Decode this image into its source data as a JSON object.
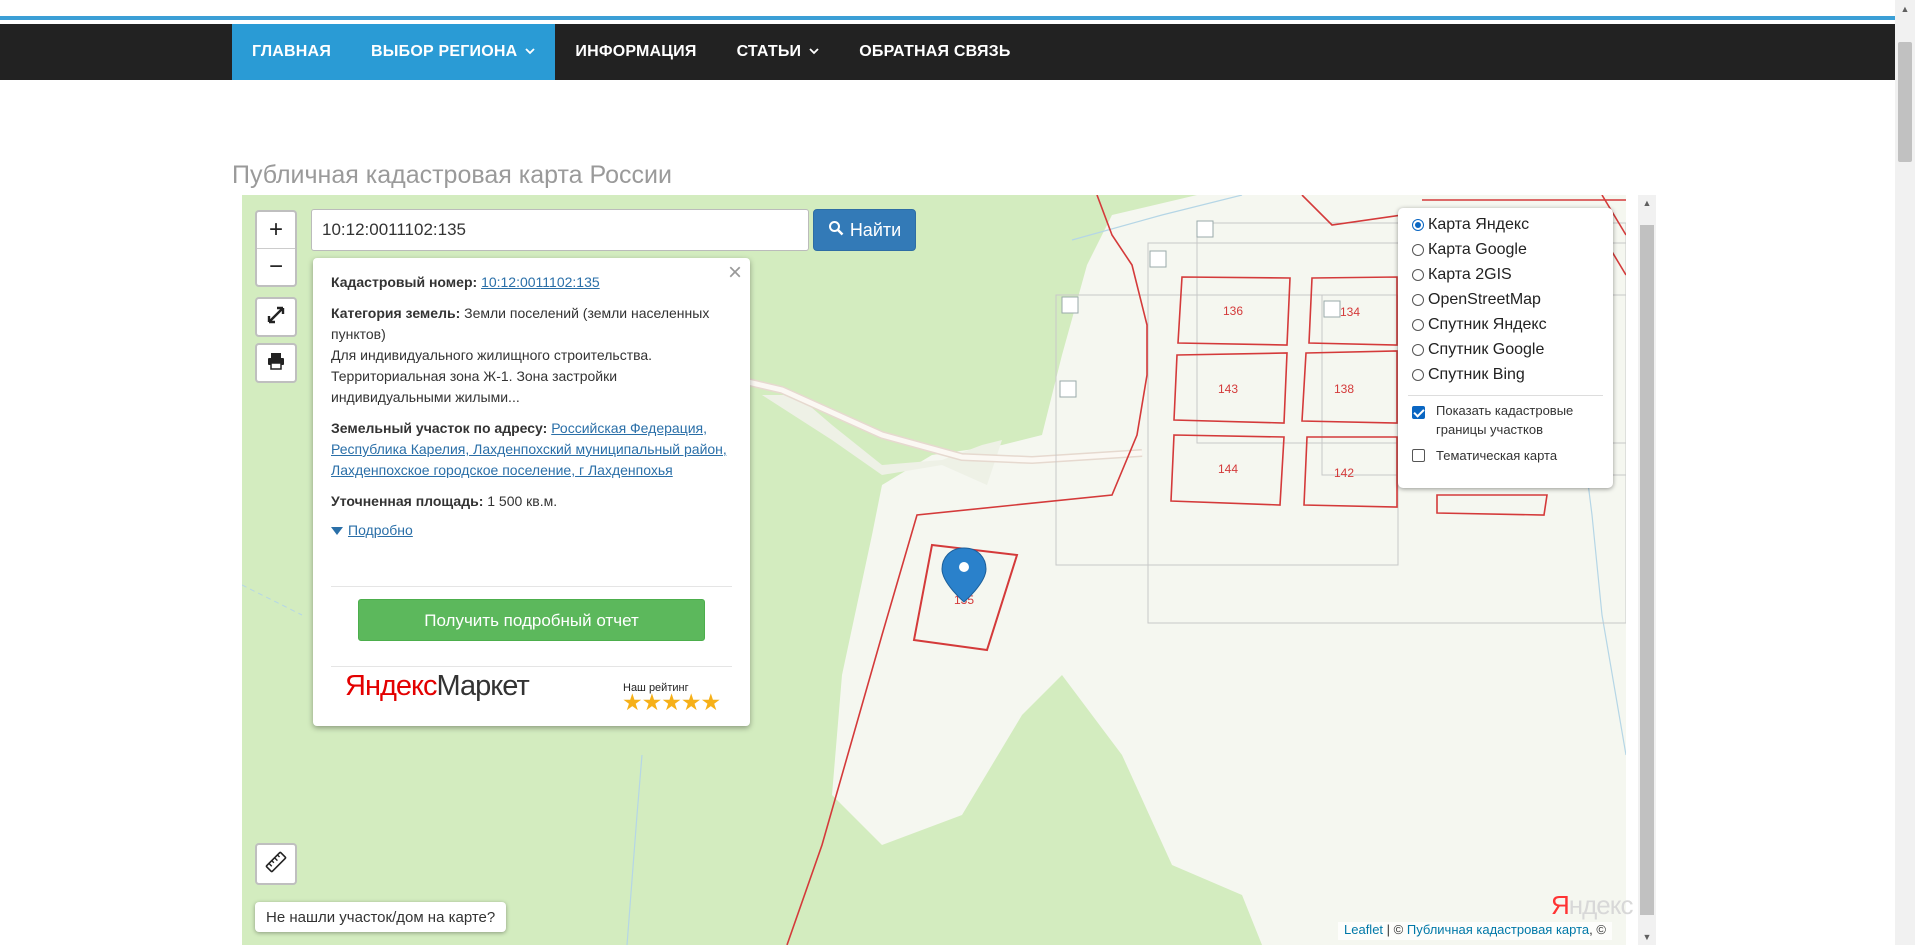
{
  "nav": {
    "items": [
      {
        "label": "ГЛАВНАЯ",
        "active": true,
        "dropdown": false
      },
      {
        "label": "ВЫБОР РЕГИОНА",
        "active": true,
        "dropdown": true
      },
      {
        "label": "ИНФОРМАЦИЯ",
        "active": false,
        "dropdown": false
      },
      {
        "label": "СТАТЬИ",
        "active": false,
        "dropdown": true
      },
      {
        "label": "ОБРАТНАЯ СВЯЗЬ",
        "active": false,
        "dropdown": false
      }
    ],
    "caret": "⌄"
  },
  "page": {
    "title": "Публичная кадастровая карта России"
  },
  "map": {
    "zoom_in": "+",
    "zoom_out": "−",
    "search": {
      "value": "10:12:0011102:135",
      "button": "Найти"
    },
    "popup": {
      "close": "×",
      "cad_label": "Кадастровый номер:",
      "cad_value": "10:12:0011102:135",
      "cat_label": "Категория земель:",
      "cat_value": "Земли поселений (земли населенных пунктов)",
      "use_text": "Для индивидуального жилищного строительства. Территориальная зона Ж-1. Зона застройки индивидуальными жилыми...",
      "addr_label": "Земельный участок по адресу:",
      "addr_value": "Российская Федерация, Республика Карелия, Лахденпохский муниципальный район, Лахденпохское городское поселение, г Лахденпохья",
      "area_label": "Уточненная площадь:",
      "area_value": "1 500 кв.м.",
      "more": "Подробно",
      "report_button": "Получить подробный отчет",
      "market_y": "Яндекс",
      "market_rest": "Маркет",
      "rating_label": "Наш рейтинг",
      "rating": 5,
      "stars": "★★★★★"
    },
    "layers": {
      "options": [
        "Карта Яндекс",
        "Карта Google",
        "Карта 2GIS",
        "OpenStreetMap",
        "Спутник Яндекс",
        "Спутник Google",
        "Спутник Bing"
      ],
      "selected": "Карта Яндекс",
      "show_boundaries": "Показать кадастровые границы участков",
      "show_boundaries_checked": true,
      "thematic": "Тематическая карта",
      "thematic_checked": false
    },
    "parcels": [
      "136",
      "134",
      "143",
      "138",
      "144",
      "142",
      "135"
    ],
    "notfound": "Не нашли участок/дом на карте?",
    "logo_y": "Я",
    "logo_rest": "ндекс",
    "attribution": {
      "leaflet": "Leaflet",
      "sep": " | © ",
      "pkk": "Публичная кадастровая карта",
      "tail": ", ©"
    },
    "colors": {
      "green": "#d3ecbf",
      "parcel": "#d43a3a",
      "marker": "#2a81cb",
      "nav_active": "#2a9bd5"
    }
  }
}
